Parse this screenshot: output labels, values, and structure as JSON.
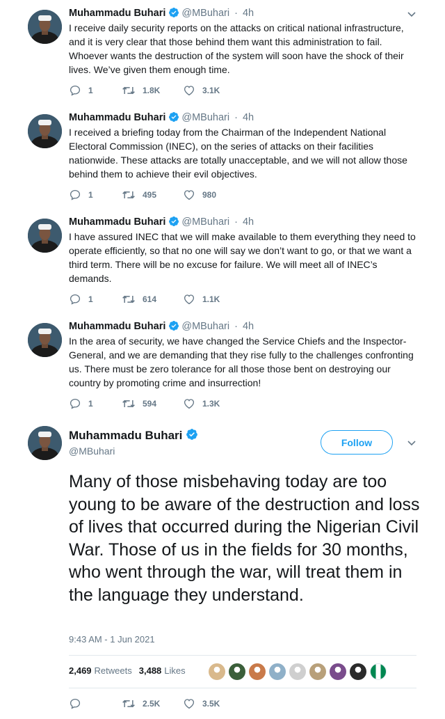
{
  "colors": {
    "accent": "#1da1f2",
    "muted": "#657786",
    "text": "#14171a",
    "divider": "#e1e8ed"
  },
  "author": {
    "name": "Muhammadu Buhari",
    "handle": "@MBuhari"
  },
  "tweets": [
    {
      "time": "4h",
      "text": "I receive daily security reports on the attacks on critical national infrastructure, and it is very clear that those behind them want this administration to fail. Whoever wants the destruction of the system will soon have the shock of their lives. We’ve given them enough time.",
      "replies": "1",
      "retweets": "1.8K",
      "likes": "3.1K"
    },
    {
      "time": "4h",
      "text": "I received a briefing today from the Chairman of the Independent National Electoral Commission (INEC), on the series of attacks on their facilities nationwide. These attacks are totally unacceptable, and we will not allow those behind them to achieve their evil objectives.",
      "replies": "1",
      "retweets": "495",
      "likes": "980"
    },
    {
      "time": "4h",
      "text": "I have assured INEC that we will make available to them everything they need to operate efficiently, so that no one will say we don’t want to go, or that we want a third term. There will be no excuse for failure. We will meet all of INEC’s demands.",
      "replies": "1",
      "retweets": "614",
      "likes": "1.1K"
    },
    {
      "time": "4h",
      "text": "In the area of security, we have changed the Service Chiefs and the Inspector-General, and we are demanding that they rise fully to the challenges confronting us. There must be zero tolerance for all those those bent on destroying our country by promoting crime and insurrection!",
      "replies": "1",
      "retweets": "594",
      "likes": "1.3K"
    }
  ],
  "main_tweet": {
    "follow_label": "Follow",
    "text": "Many of those misbehaving today are too young to be aware of the destruction and loss of lives that occurred during the Nigerian Civil War. Those of us in the fields for 30 months, who went through the war, will treat them in the language they understand.",
    "timestamp": "9:43 AM - 1 Jun 2021",
    "retweets_count": "2,469",
    "retweets_label": "Retweets",
    "likes_count": "3,488",
    "likes_label": "Likes",
    "retweets": "2.5K",
    "likes": "3.5K",
    "liker_avatar_colors": [
      "#d9b98c",
      "#3b5f3a",
      "#c97a4a",
      "#8fb0c8",
      "#cfcfcf",
      "#b8a07a",
      "#7a4c8c",
      "#2b2b2b",
      "#008751"
    ]
  }
}
